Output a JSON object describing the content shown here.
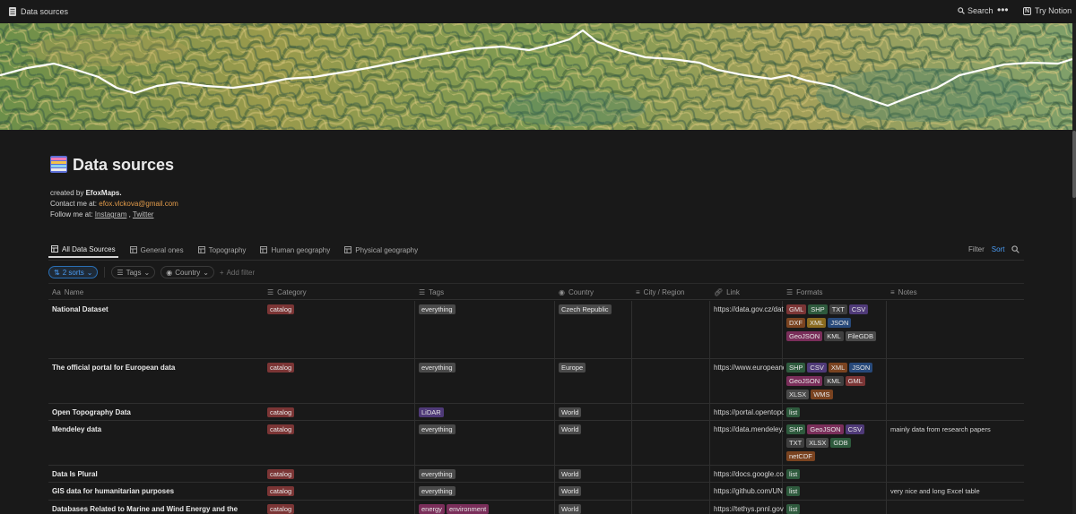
{
  "topbar": {
    "breadcrumb": "Data sources",
    "search_label": "Search",
    "more_label": "•••",
    "try_label": "Try Notion"
  },
  "page": {
    "title": "Data sources",
    "created_prefix": "created by ",
    "created_by": "EfoxMaps.",
    "contact_prefix": "Contact me at: ",
    "email": "efox.vlckova@gmail.com",
    "follow_prefix": "Follow me at: ",
    "instagram": "Instagram",
    "comma": " , ",
    "twitter": "Twitter"
  },
  "views": [
    {
      "label": "All Data Sources",
      "active": true
    },
    {
      "label": "General ones"
    },
    {
      "label": "Topography"
    },
    {
      "label": "Human geography"
    },
    {
      "label": "Physical geography"
    }
  ],
  "toolbar": {
    "filter": "Filter",
    "sort": "Sort"
  },
  "filters": {
    "sorts": "2 sorts",
    "tags": "Tags",
    "country": "Country",
    "add": "Add filter"
  },
  "columns": [
    "Name",
    "Category",
    "Tags",
    "Country",
    "City / Region",
    "Link",
    "Formats",
    "Notes"
  ],
  "colors": {
    "catalog": "#7b3535",
    "everything": "#4a4a4a",
    "world": "#4a4a4a",
    "country": "#4a4a4a",
    "lidar": "#4f3a78",
    "energy": "#7a2e5a",
    "environment": "#7a2e5a",
    "list": "#2e5a3d",
    "accent": "#4a9cf5"
  },
  "rows": [
    {
      "name": "National Dataset",
      "category": "catalog",
      "tags": [
        "everything"
      ],
      "country": "Czech Republic",
      "link": "https://data.gov.cz/datové-sady",
      "formats": [
        [
          "GML",
          "#7b3535"
        ],
        [
          "SHP",
          "#2e5a3d"
        ],
        [
          "TXT",
          "#3f3f3f"
        ],
        [
          "CSV",
          "#4f3a78"
        ],
        [
          "DXF",
          "#7a4320"
        ],
        [
          "XML",
          "#8a6a1f"
        ],
        [
          "JSON",
          "#27497a"
        ],
        [
          "GeoJSON",
          "#7a2e5a"
        ],
        [
          "KML",
          "#3f3f3f"
        ],
        [
          "FileGDB",
          "#4a4a4a"
        ]
      ],
      "notes": ""
    },
    {
      "name": "The official portal for European data",
      "category": "catalog",
      "tags": [
        "everything"
      ],
      "country": "Europe",
      "link": "https://www.europeandataportal.eu",
      "formats": [
        [
          "SHP",
          "#2e5a3d"
        ],
        [
          "CSV",
          "#4f3a78"
        ],
        [
          "XML",
          "#7a4320"
        ],
        [
          "JSON",
          "#27497a"
        ],
        [
          "GeoJSON",
          "#7a2e5a"
        ],
        [
          "KML",
          "#3f3f3f"
        ],
        [
          "GML",
          "#7b3535"
        ],
        [
          "XLSX",
          "#4a4a4a"
        ],
        [
          "WMS",
          "#7a4320"
        ]
      ],
      "notes": ""
    },
    {
      "name": "Open Topography Data",
      "category": "catalog",
      "tags": [
        "LiDAR"
      ],
      "country": "World",
      "link": "https://portal.opentopography.org",
      "formats": [
        [
          "list",
          "#2e5a3d"
        ]
      ],
      "notes": ""
    },
    {
      "name": "Mendeley data",
      "category": "catalog",
      "tags": [
        "everything"
      ],
      "country": "World",
      "link": "https://data.mendeley.com",
      "formats": [
        [
          "SHP",
          "#2e5a3d"
        ],
        [
          "GeoJSON",
          "#7a2e5a"
        ],
        [
          "CSV",
          "#4f3a78"
        ],
        [
          "TXT",
          "#3f3f3f"
        ],
        [
          "XLSX",
          "#4a4a4a"
        ],
        [
          "GDB",
          "#2e5a3d"
        ],
        [
          "netCDF",
          "#7a4320"
        ]
      ],
      "notes": "mainly data from research papers"
    },
    {
      "name": "Data Is Plural",
      "category": "catalog",
      "tags": [
        "everything"
      ],
      "country": "World",
      "link": "https://docs.google.com",
      "formats": [
        [
          "list",
          "#2e5a3d"
        ]
      ],
      "notes": ""
    },
    {
      "name": "GIS data for humanitarian purposes",
      "category": "catalog",
      "tags": [
        "everything"
      ],
      "country": "World",
      "link": "https://github.com/UN",
      "formats": [
        [
          "list",
          "#2e5a3d"
        ]
      ],
      "notes": "very nice and long Excel table"
    },
    {
      "name": "Databases Related to Marine and Wind Energy and the",
      "category": "catalog",
      "tags": [
        "energy",
        "environment"
      ],
      "country": "World",
      "link": "https://tethys.pnnl.gov",
      "formats": [
        [
          "list",
          "#2e5a3d"
        ]
      ],
      "notes": ""
    }
  ]
}
